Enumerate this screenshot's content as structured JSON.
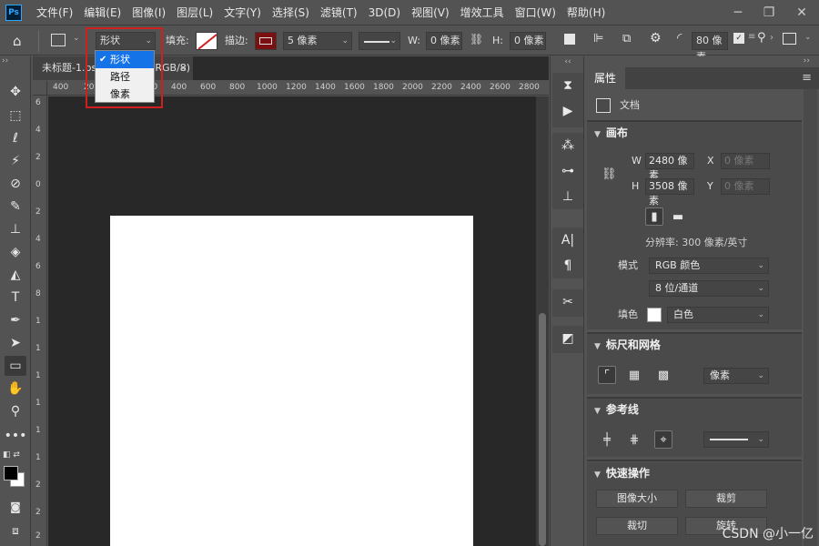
{
  "menubar": {
    "logo": "Ps",
    "items": [
      "文件(F)",
      "编辑(E)",
      "图像(I)",
      "图层(L)",
      "文字(Y)",
      "选择(S)",
      "滤镜(T)",
      "3D(D)",
      "视图(V)",
      "增效工具",
      "窗口(W)",
      "帮助(H)"
    ],
    "window_controls": [
      "minimize-icon",
      "restore-icon",
      "close-icon"
    ]
  },
  "options": {
    "mode_value": "形状",
    "fill_label": "填充:",
    "stroke_label": "描边:",
    "stroke_width": "5 像素",
    "w_label": "W:",
    "w_value": "0 像素",
    "h_label": "H:",
    "h_value": "0 像素",
    "radius_value": "80 像素",
    "stroke_color": "#7a1010"
  },
  "mode_dropdown": {
    "options": [
      "形状",
      "路径",
      "像素"
    ],
    "selected": "形状",
    "check": "✔"
  },
  "document": {
    "tab_title": "未标题-1.psd @ 16.7%(RGB/8)",
    "close": "×"
  },
  "ruler": {
    "top_labels": [
      "400",
      "200",
      "0",
      "200",
      "400",
      "600",
      "800",
      "1000",
      "1200",
      "1400",
      "1600",
      "1800",
      "2000",
      "2200",
      "2400",
      "2600",
      "2800"
    ],
    "left_labels": [
      "6",
      "4",
      "2",
      "0",
      "2",
      "4",
      "6",
      "8",
      "1",
      "1",
      "1",
      "1",
      "1",
      "1",
      "2",
      "2",
      "2"
    ]
  },
  "properties": {
    "tab": "属性",
    "doc_label": "文档",
    "canvas": {
      "title": "画布",
      "w_label": "W",
      "w_value": "2480 像素",
      "x_label": "X",
      "x_value": "0 像素",
      "h_label": "H",
      "h_value": "3508 像素",
      "y_label": "Y",
      "y_value": "0 像素",
      "resolution": "分辨率: 300 像素/英寸",
      "mode_label": "模式",
      "mode_value": "RGB 颜色",
      "depth_value": "8 位/通道",
      "fill_label": "填色",
      "fill_value": "白色"
    },
    "rulers_grids": {
      "title": "标尺和网格",
      "unit_value": "像素"
    },
    "guides": {
      "title": "参考线"
    },
    "quick_actions": {
      "title": "快速操作",
      "buttons": [
        "图像大小",
        "裁剪",
        "裁切",
        "旋转"
      ]
    }
  },
  "watermark": "CSDN @小一亿"
}
